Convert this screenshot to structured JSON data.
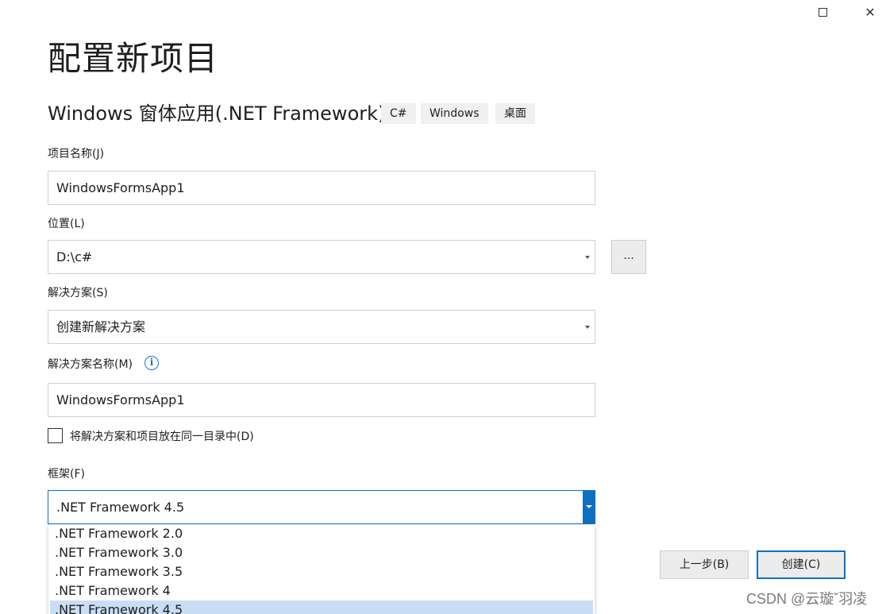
{
  "window": {
    "maximize_icon": "maximize-icon",
    "close_icon": "close-icon",
    "close_glyph": "✕"
  },
  "page": {
    "title": "配置新项目",
    "template_name": "Windows 窗体应用(.NET Framework)",
    "tags": [
      "C#",
      "Windows",
      "桌面"
    ]
  },
  "form": {
    "project_name_label": "项目名称(J)",
    "project_name_value": "WindowsFormsApp1",
    "location_label": "位置(L)",
    "location_value": "D:\\c#",
    "browse_label": "...",
    "solution_label": "解决方案(S)",
    "solution_value": "创建新解决方案",
    "solution_name_label": "解决方案名称(M)",
    "solution_name_info": "i",
    "solution_name_value": "WindowsFormsApp1",
    "same_dir_label": "将解决方案和项目放在同一目录中(D)",
    "same_dir_checked": false,
    "framework_label": "框架(F)",
    "framework_value": ".NET Framework 4.5",
    "framework_options": [
      ".NET Framework 2.0",
      ".NET Framework 3.0",
      ".NET Framework 3.5",
      ".NET Framework 4",
      ".NET Framework 4.5"
    ],
    "framework_selected_index": 4
  },
  "buttons": {
    "back": "上一步(B)",
    "create": "创建(C)"
  },
  "watermark": "CSDN @云璇ˇ羽凌",
  "colors": {
    "accent": "#0e70c0",
    "selected_option": "#c9def5",
    "button_bg": "#ececec"
  }
}
